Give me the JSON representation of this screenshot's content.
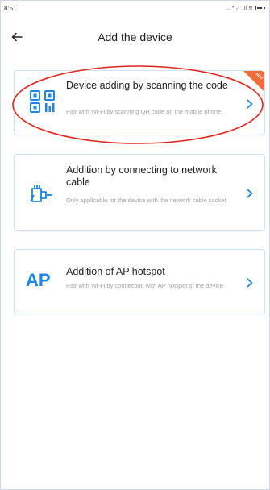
{
  "status_bar": {
    "time": "8:51",
    "icons_text": "... * ☄ .ıl ≋"
  },
  "header": {
    "title": "Add the device",
    "back_icon": "arrow-left-icon"
  },
  "options": [
    {
      "title": "Device adding by scanning the code",
      "description": "Pair with Wi-Fi by scanning QR code on the mobile phone",
      "icon": "qr-code-icon",
      "badge": "HOT"
    },
    {
      "title": "Addition by connecting to network cable",
      "description": "Only applicable for the device with the network cable socket",
      "icon": "ethernet-cable-icon"
    },
    {
      "title": "Addition of AP hotspot",
      "description": "Pair with Wi-Fi by connection with AP hotspot of the device",
      "icon_text": "AP"
    }
  ],
  "colors": {
    "accent": "#1c86e6",
    "card_border": "#cfe1f5",
    "hot_badge": "#f26b3a",
    "annotation_ellipse": "#e2251b"
  }
}
